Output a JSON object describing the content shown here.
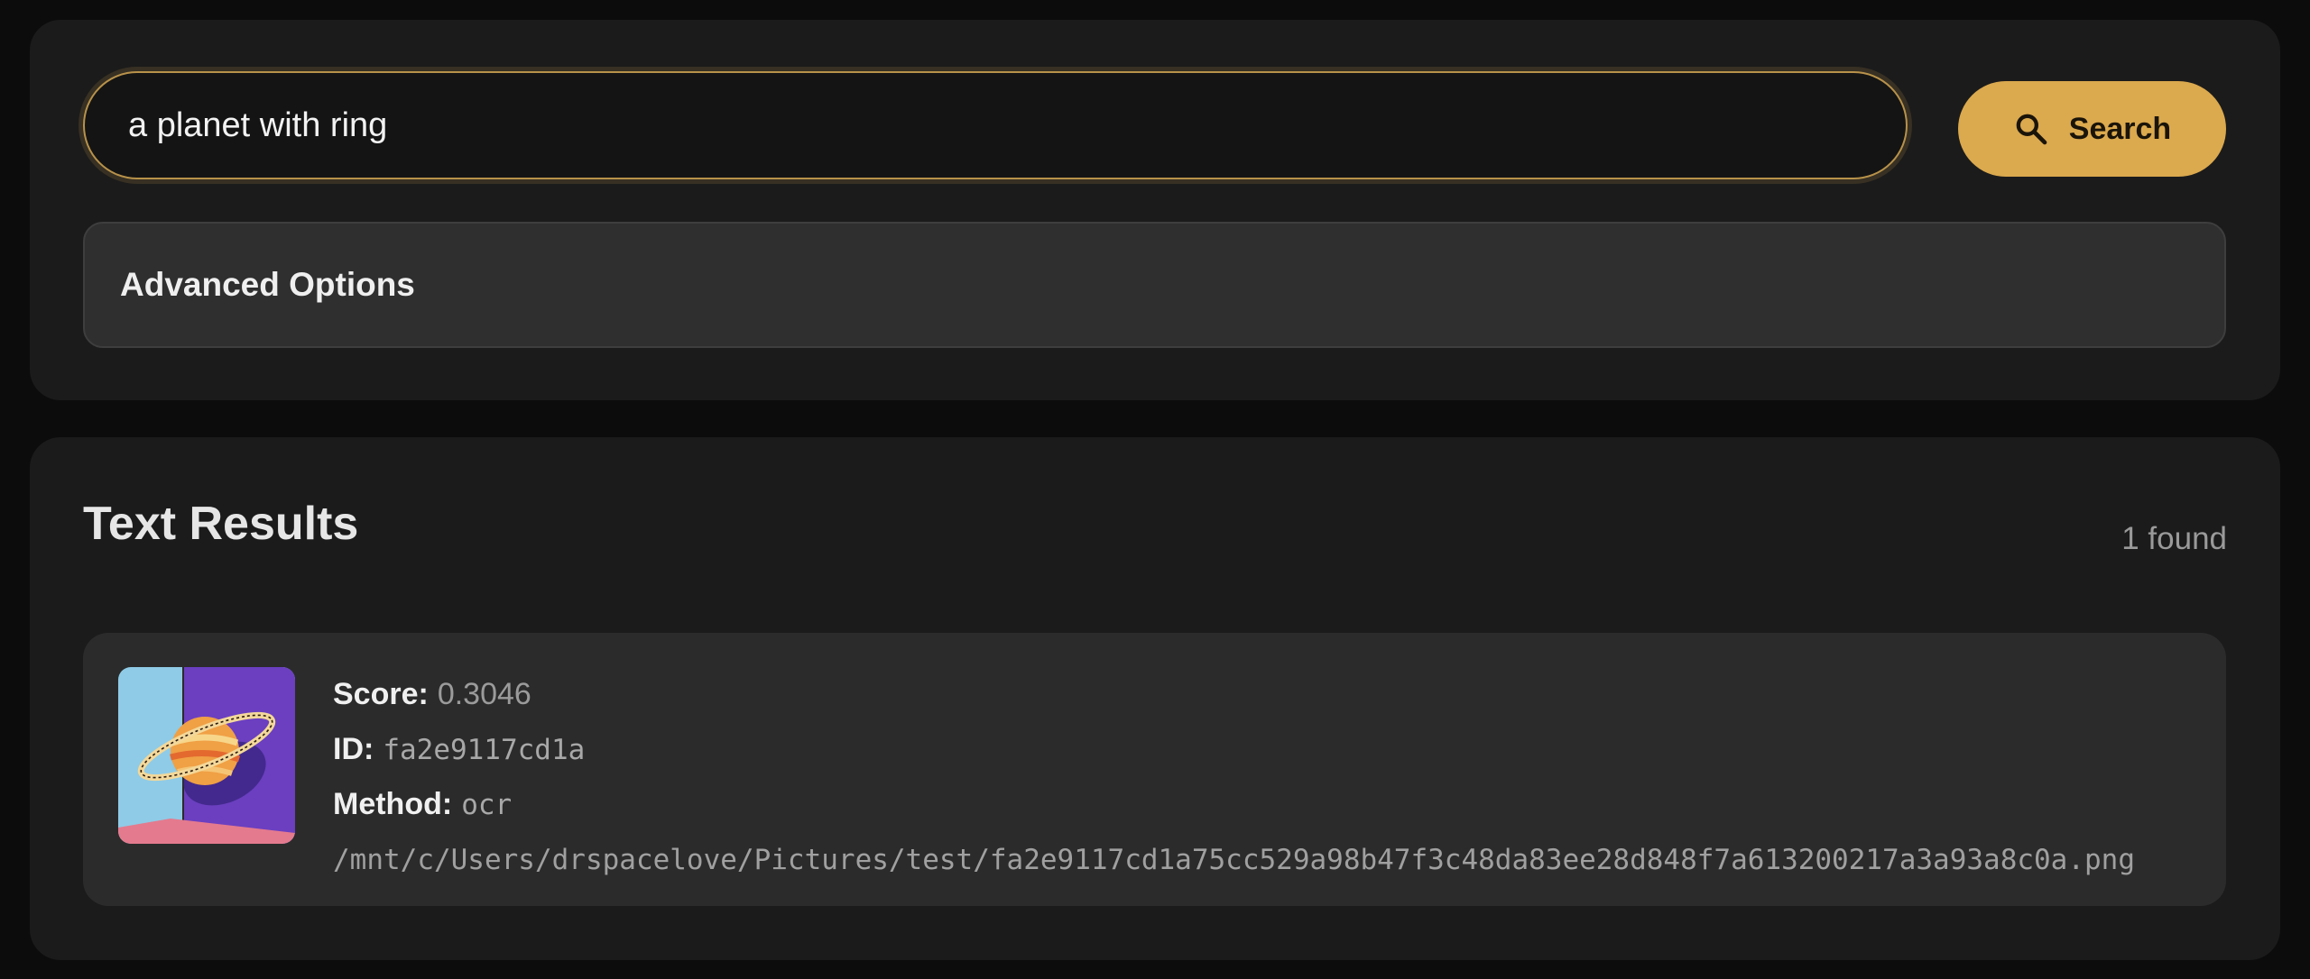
{
  "search": {
    "value": "a planet with ring",
    "button_label": "Search"
  },
  "advanced": {
    "label": "Advanced Options"
  },
  "results": {
    "title": "Text Results",
    "count_label": "1 found",
    "items": [
      {
        "score_label": "Score:",
        "score": "0.3046",
        "id_label": "ID:",
        "id": "fa2e9117cd1a",
        "method_label": "Method:",
        "method": "ocr",
        "path": "/mnt/c/Users/drspacelove/Pictures/test/fa2e9117cd1a75cc529a98b47f3c48da83ee28d848f7a613200217a3a93a8c0a.png",
        "thumbnail_icon": "ringed-planet-thumbnail"
      }
    ]
  },
  "colors": {
    "accent": "#dba94e",
    "background": "#0c0c0c",
    "panel": "#1b1b1b",
    "card": "#2b2b2b"
  }
}
